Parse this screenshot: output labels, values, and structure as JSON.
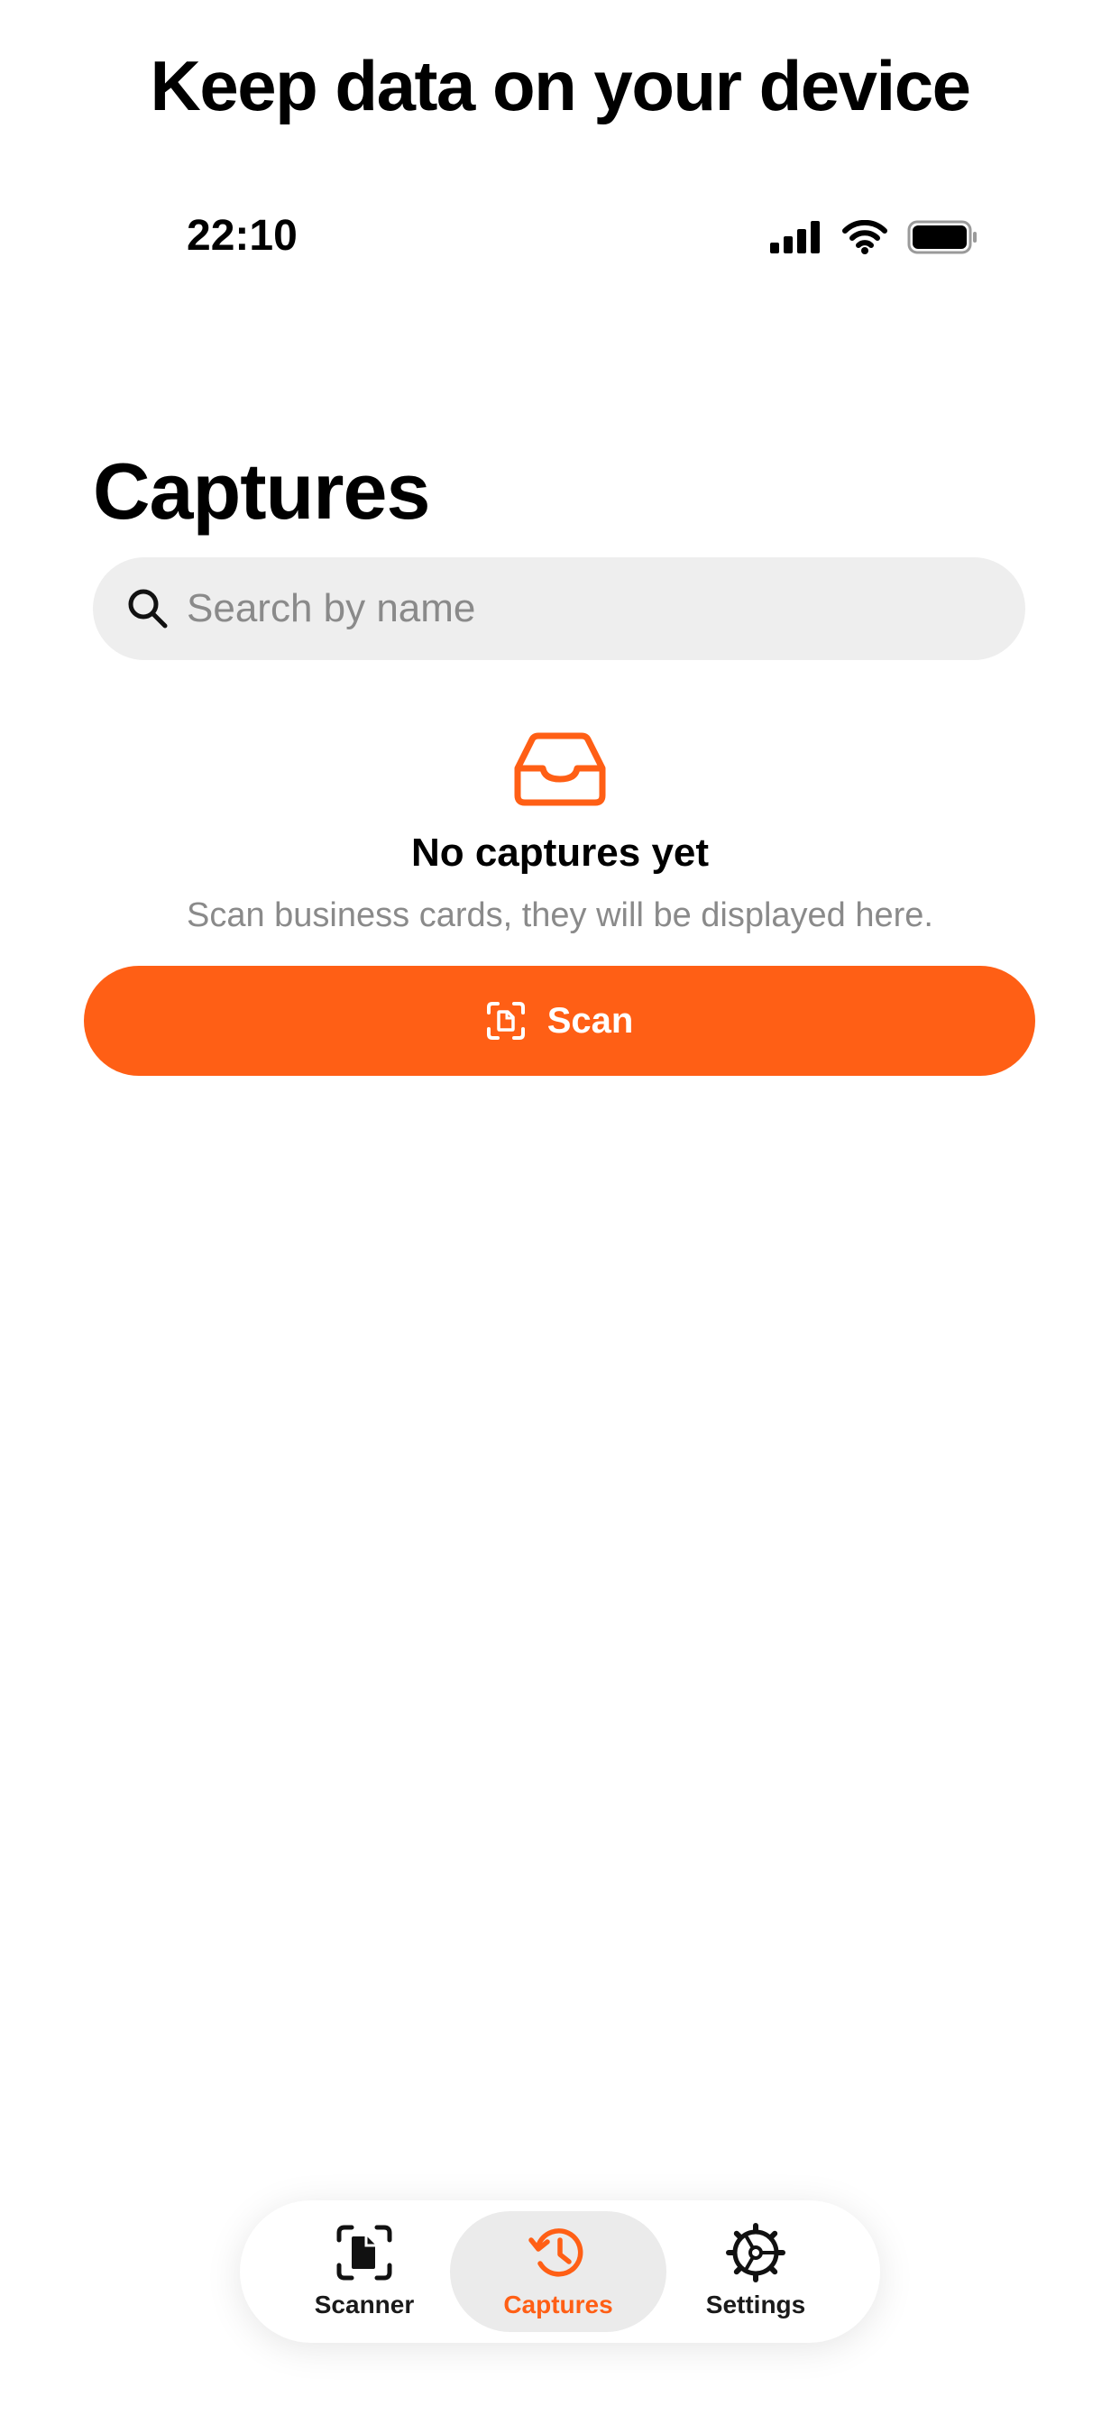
{
  "headline": "Keep data on your device",
  "status_bar": {
    "time": "22:10",
    "icons": [
      "cellular-signal-icon",
      "wifi-icon",
      "battery-icon"
    ]
  },
  "page": {
    "title": "Captures"
  },
  "search": {
    "placeholder": "Search by name",
    "value": "",
    "icon": "search-icon"
  },
  "empty_state": {
    "icon": "inbox-icon",
    "title": "No captures yet",
    "subtitle": "Scan business cards, they will be displayed here."
  },
  "scan_button": {
    "label": "Scan",
    "icon": "scan-document-icon"
  },
  "tab_bar": {
    "tabs": [
      {
        "label": "Scanner",
        "icon": "scanner-icon",
        "active": false
      },
      {
        "label": "Captures",
        "icon": "history-icon",
        "active": true
      },
      {
        "label": "Settings",
        "icon": "gear-icon",
        "active": false
      }
    ]
  },
  "colors": {
    "accent": "#ff5f15",
    "search_background": "#eeeeee",
    "secondary_text": "#8a8a8a",
    "active_tab_background": "#ebebeb"
  }
}
